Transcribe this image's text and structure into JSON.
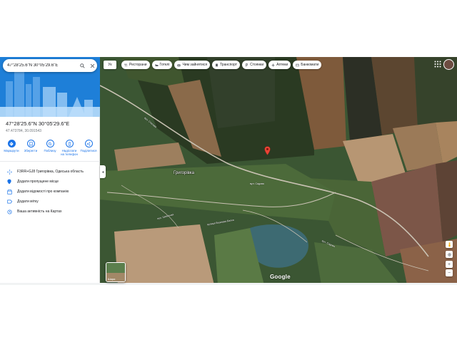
{
  "search": {
    "value": "47°28'25.6\"N 30°05'29.6\"E"
  },
  "place": {
    "title": "47°28'25.6\"N 30°05'29.6\"E",
    "coordinates": "47.473784, 30.091543"
  },
  "actions": [
    {
      "label": "Маршрути",
      "icon": "directions-icon"
    },
    {
      "label": "Зберегти",
      "icon": "bookmark-icon"
    },
    {
      "label": "Поблизу",
      "icon": "nearby-icon"
    },
    {
      "label": "Надіслати на телефон",
      "icon": "phone-icon"
    },
    {
      "label": "Поділитися",
      "icon": "share-icon"
    }
  ],
  "details": [
    {
      "text": "F3RR+GJ8 Григорівка, Одеська область",
      "icon": "plus-code-icon"
    },
    {
      "text": "Додати пропущене місце",
      "icon": "add-place-icon"
    },
    {
      "text": "Додати відомості про компанію",
      "icon": "business-icon"
    },
    {
      "text": "Додати мітку",
      "icon": "label-icon"
    },
    {
      "text": "Ваша активність на Картах",
      "icon": "history-icon"
    }
  ],
  "map": {
    "language_chip": "Ук",
    "chips": [
      {
        "label": "Ресторани",
        "icon": "restaurant-icon"
      },
      {
        "label": "Готелі",
        "icon": "hotel-icon"
      },
      {
        "label": "Чим зайнятися",
        "icon": "camera-icon"
      },
      {
        "label": "Транспорт",
        "icon": "transit-icon"
      },
      {
        "label": "Стоянки",
        "icon": "parking-icon"
      },
      {
        "label": "Аптеки",
        "icon": "pharmacy-icon"
      },
      {
        "label": "Банкомати",
        "icon": "atm-icon"
      }
    ],
    "village_label": "Григорівка",
    "street_labels": [
      "вул. Степова",
      "вул. Садова",
      "вул. Шевченка",
      "вулиця Вишнева Балка",
      "вул. Садова"
    ],
    "layers_label": "Шари",
    "logo": "Google",
    "colors": {
      "pin": "#ea4335",
      "accent": "#1a73e8"
    }
  }
}
